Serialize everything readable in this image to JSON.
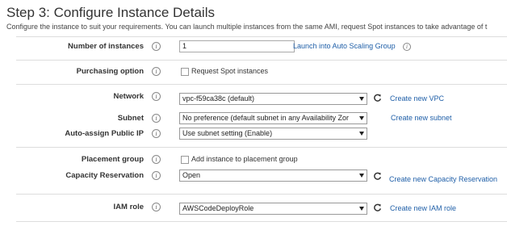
{
  "header": {
    "title": "Step 3: Configure Instance Details",
    "description": "Configure the instance to suit your requirements. You can launch multiple instances from the same AMI, request Spot instances to take advantage of t"
  },
  "form": {
    "number_of_instances": {
      "label": "Number of instances",
      "value": "1",
      "link": "Launch into Auto Scaling Group"
    },
    "purchasing_option": {
      "label": "Purchasing option",
      "checkbox_label": "Request Spot instances"
    },
    "network": {
      "label": "Network",
      "value": "vpc-f59ca38c (default)",
      "link": "Create new VPC"
    },
    "subnet": {
      "label": "Subnet",
      "value": "No preference (default subnet in any Availability Zor",
      "link": "Create new subnet"
    },
    "auto_assign_public_ip": {
      "label": "Auto-assign Public IP",
      "value": "Use subnet setting (Enable)"
    },
    "placement_group": {
      "label": "Placement group",
      "checkbox_label": "Add instance to placement group"
    },
    "capacity_reservation": {
      "label": "Capacity Reservation",
      "value": "Open",
      "link": "Create new Capacity Reservation"
    },
    "iam_role": {
      "label": "IAM role",
      "value": "AWSCodeDeployRole",
      "link": "Create new IAM role"
    }
  },
  "icons": {
    "info": "info-icon",
    "refresh": "refresh-icon",
    "dropdown": "chevron-down-icon"
  },
  "colors": {
    "link": "#1f5fa8",
    "divider": "#dddddd"
  }
}
